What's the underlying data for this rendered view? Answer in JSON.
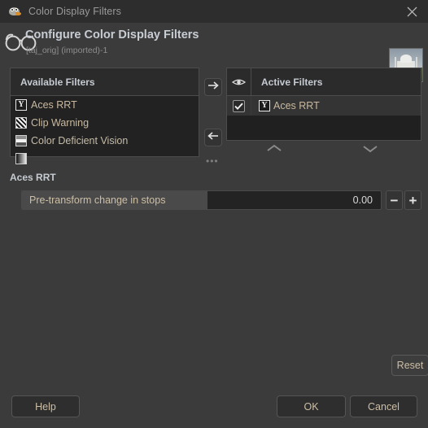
{
  "window": {
    "title": "Color Display Filters",
    "app_icon": "wilber-icon",
    "close_icon": "close-icon"
  },
  "header": {
    "icon": "glasses-icon",
    "title": "Configure Color Display Filters",
    "subtitle": "[taj_orig] (imported)-1",
    "thumbnail": "image-thumbnail"
  },
  "available": {
    "header": "Available Filters",
    "items": [
      {
        "label": "Aces RRT",
        "icon": "aces-rrt-icon"
      },
      {
        "label": "Clip Warning",
        "icon": "clip-warning-icon"
      },
      {
        "label": "Color Deficient Vision",
        "icon": "color-deficient-vision-icon"
      },
      {
        "label": "",
        "icon": "gamma-icon"
      }
    ]
  },
  "active": {
    "eye_header_icon": "eye-icon",
    "header": "Active Filters",
    "items": [
      {
        "label": "Aces RRT",
        "icon": "aces-rrt-icon",
        "checked": true,
        "check_glyph": "✔"
      }
    ]
  },
  "transfer": {
    "add_icon": "arrow-right-icon",
    "remove_icon": "arrow-left-icon",
    "overflow": "•••"
  },
  "reorder": {
    "up_icon": "chevron-up-icon",
    "down_icon": "chevron-down-icon"
  },
  "parameters": {
    "section_title": "Aces RRT",
    "slider": {
      "label": "Pre-transform change in stops",
      "value": "0.00",
      "minus_label": "−",
      "plus_label": "+"
    }
  },
  "footer": {
    "reset_label": "Reset",
    "help_label": "Help",
    "ok_label": "OK",
    "cancel_label": "Cancel"
  },
  "colors": {
    "window_bg": "#3b3b3b",
    "titlebar_bg": "#2d2d2d",
    "list_bg": "#222222",
    "selected_row": "#343434",
    "text": "#cdbfa6",
    "heading": "#c6cbd2"
  }
}
